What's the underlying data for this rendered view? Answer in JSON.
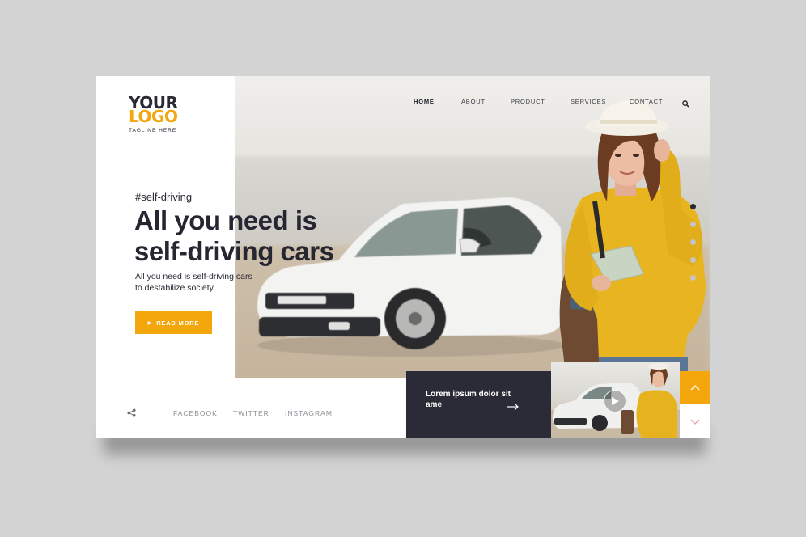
{
  "logo": {
    "line1": "YOUR",
    "line2": "LOGO",
    "tagline": "TAGLINE HERE"
  },
  "nav": {
    "items": [
      {
        "label": "HOME",
        "active": true
      },
      {
        "label": "ABOUT"
      },
      {
        "label": "PRODUCT"
      },
      {
        "label": "SERVICES"
      },
      {
        "label": "CONTACT"
      }
    ],
    "search_icon": "search-icon"
  },
  "hero": {
    "hashtag": "#self-driving",
    "headline_line1": "All you need is",
    "headline_line2": "self-driving cars",
    "subtext_line1": "All you need is self-driving cars",
    "subtext_line2": "to destabilize society.",
    "cta_label": "READ MORE"
  },
  "slider": {
    "count": 5,
    "active_index": 0
  },
  "social": {
    "share_icon": "share-icon",
    "links": [
      "FACEBOOK",
      "TWITTER",
      "INSTAGRAM"
    ]
  },
  "promo": {
    "text": "Lorem ipsum dolor sit ame",
    "arrow_icon": "arrow-right-icon"
  },
  "video": {
    "play_icon": "play-icon"
  },
  "scroll": {
    "up_icon": "chevron-up-icon",
    "down_icon": "chevron-down-icon"
  },
  "colors": {
    "accent": "#f4a60d",
    "dark": "#2b2b37",
    "background": "#d3d3d3"
  }
}
